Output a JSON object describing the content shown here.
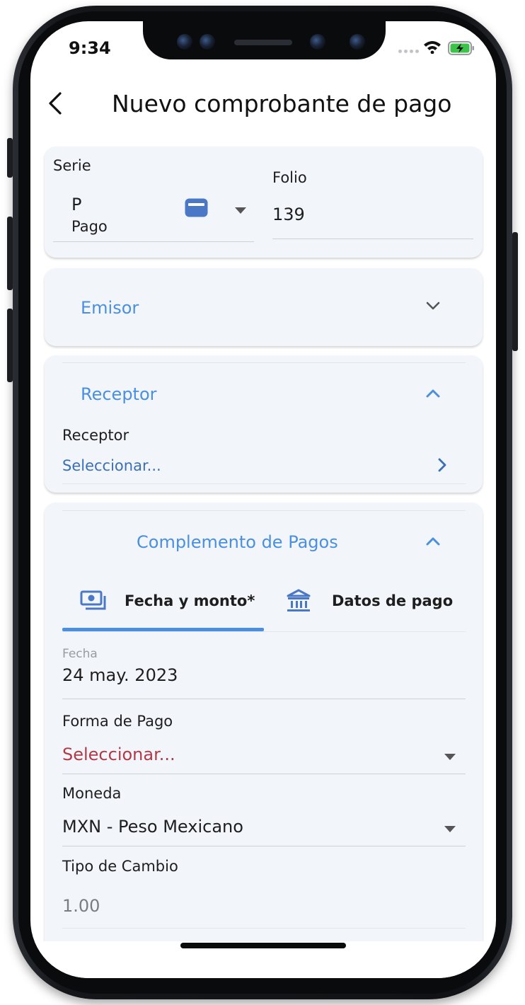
{
  "status_bar": {
    "time": "9:34"
  },
  "header": {
    "title": "Nuevo comprobante de pago"
  },
  "serie_folio": {
    "serie_label": "Serie",
    "serie_code": "P",
    "serie_name": "Pago",
    "folio_label": "Folio",
    "folio_value": "139"
  },
  "emisor": {
    "title": "Emisor",
    "expanded": false
  },
  "receptor": {
    "title": "Receptor",
    "expanded": true,
    "field_label": "Receptor",
    "field_value": "Seleccionar..."
  },
  "complemento": {
    "title": "Complemento de Pagos",
    "expanded": true,
    "tabs": [
      {
        "label": "Fecha y monto*",
        "icon": "money-icon",
        "active": true
      },
      {
        "label": "Datos de pago",
        "icon": "bank-icon",
        "active": false
      }
    ],
    "fecha_label": "Fecha",
    "fecha_value": "24 may. 2023",
    "forma_pago_label": "Forma de Pago",
    "forma_pago_value": "Seleccionar...",
    "moneda_label": "Moneda",
    "moneda_value": "MXN - Peso Mexicano",
    "tipo_cambio_label": "Tipo de Cambio",
    "tipo_cambio_value": "1.00"
  },
  "colors": {
    "accent": "#4a8fe0",
    "link": "#3b6fb8",
    "error": "#b23a48",
    "card_bg": "#f2f5fa"
  }
}
